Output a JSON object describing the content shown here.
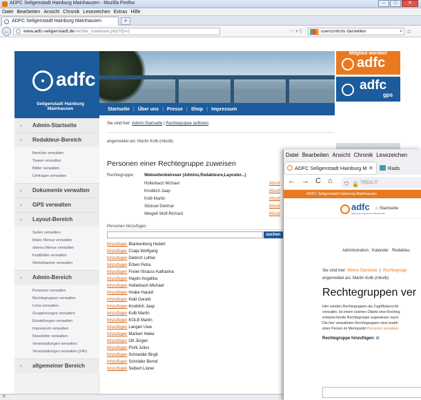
{
  "win1": {
    "title": "ADFC Seligenstadt Hainburg Mainhausen - Mozilla Firefox",
    "window_buttons": [
      "–",
      "□",
      "✕"
    ],
    "menu": [
      "Datei",
      "Bearbeiten",
      "Ansicht",
      "Chronik",
      "Lesezeichen",
      "Extras",
      "Hilfe"
    ],
    "tab_title": "ADFC Seligenstadt Hainburg Mainhausen",
    "new_tab": "+",
    "url_host": "www.adfc-seligenstadt.de",
    "url_path": "/rechte_zuweisen.php?ID=2",
    "url_icons": "☆ ▾ C",
    "search_value": "usercontrols darstellen",
    "status_text": "✕"
  },
  "page": {
    "logo_word": "adfc",
    "club_name": "Seligenstadt Hainburg Mainhausen",
    "menu": [
      {
        "label": "Admin-Startseite",
        "items": []
      },
      {
        "label": "Redakteur-Bereich",
        "items": [
          "Berichte verwalten",
          "Teaser verwalten",
          "Bilder verwalten",
          "Umfragen verwalten"
        ]
      },
      {
        "label": "Dokumente verwalten",
        "items": []
      },
      {
        "label": "GPS verwalten",
        "items": []
      },
      {
        "label": "Layout-Bereich",
        "items": [
          "Seiten verwalten",
          "linkes Menue verwalten",
          "oberes Menue verwalten",
          "Kopfbilder verwalten",
          "Werbebanner verwalten"
        ]
      },
      {
        "label": "Admin-Bereich",
        "items": [
          "Personen verwalten",
          "Rechtegruppen verwalten",
          "Links verwalten",
          "Gruppierungen verwalten",
          "Einstellungen verwalten",
          "Impressum verwalten",
          "Newsletter verwalten",
          "Veranstaltungen verwalten",
          "Veranstaltungen verwalten (24h)"
        ]
      },
      {
        "label": "allgemeiner Bereich",
        "items": []
      }
    ],
    "nav": [
      "Startseite",
      "Über uns",
      "Presse",
      "Shop",
      "Impressum"
    ],
    "nav_sep": "|",
    "breadcrumb_prefix": "Sie sind hier:",
    "breadcrumb_1": "Admin-Startseite",
    "breadcrumb_sep": "|",
    "breadcrumb_2": "Rechtegruppe auflisten",
    "logged_in": "angemeldet als: Martin Kolb (mkolb)",
    "heading": "Personen einer Rechtegruppe zuweisen",
    "group_label": "Rechtegruppe:",
    "group_name": "Webseitenbetreuer (Admins,Redakteure,Layouter...)",
    "group_members": [
      "Hollerbach Michael",
      "Knoblich Jaap",
      "Kolb Martin",
      "Sticksel Dietmar",
      "Weigelt Wolf-Richard"
    ],
    "delete_link": "(lösch",
    "add_label": "Personen hinzufügen",
    "search_button": "suchen",
    "add_link": "hinzufügen",
    "persons": [
      "Blankenberg Hubert",
      "Czaja Wolfgang",
      "Dietrich Lothar",
      "Erben Petra",
      "Freier-Strauss Katharina",
      "Haydn Angelika",
      "Hollerbach Michael",
      "Hrabe Harald",
      "Klatt Gerald",
      "Knoblich Jaap",
      "Kolb Martin",
      "KOLB Martin",
      "Langen Uwe",
      "Markert Heike",
      "Ott Jürgen",
      "Pichl Julius",
      "Schneider Birgit",
      "Schröder Bernd",
      "Seibert Lionel"
    ],
    "member_banner_label": "Mitglied werden!",
    "member_banner_word": "adfc",
    "gps_word": "adfc",
    "gps_sub": "gps"
  },
  "win2": {
    "menu": [
      "Datei",
      "Bearbeiten",
      "Ansicht",
      "Chronik",
      "Lesezeichen"
    ],
    "tab_title": "ADFC Seligenstadt Hainburg M",
    "tab_close": "✕",
    "tab2_title": "Rads",
    "nav_icons": {
      "back": "←",
      "forward": "→",
      "reload": "C",
      "home": "⌂"
    },
    "url_text": "https://",
    "orange_bar": "ADFC Seligenstadt Hainburg Mainhausen",
    "logo_word": "adfc",
    "logo_sub": "Allgemeiner Deutscher Fahrrad-Club",
    "startseite": "⌂ Startseite",
    "subnav": [
      "Administration",
      "Kalender",
      "Redakteu"
    ],
    "breadcrumb_prefix": "Sie sind hier:",
    "breadcrumb_1": "Meine Startseite",
    "breadcrumb_sep": "|",
    "breadcrumb_2": "Rechtegrupp",
    "logged_in": "angemeldet als: Martin Kolb (mkolb)",
    "heading": "Rechtegruppen ver",
    "para": [
      "Hier werden Rechtegruppen als Zugriffsberechti",
      "verwaltet. Ist einem solchen Objekt eine Rechteg",
      "entsprechende Rechtegruppe zugewiesen wurd",
      "Die hier verwalteten Rechtegruppen sind unabh",
      "einer Person im Menüpunkt "
    ],
    "para_link": "Personen verwalten",
    "add_label": "Rechtegruppe hinzufügen:",
    "add_icon": "⊞",
    "search_button": "suchen"
  },
  "colors": {
    "adfc_blue": "#1c5b9c",
    "adfc_orange": "#e9791f",
    "link_orange": "#d06010"
  }
}
